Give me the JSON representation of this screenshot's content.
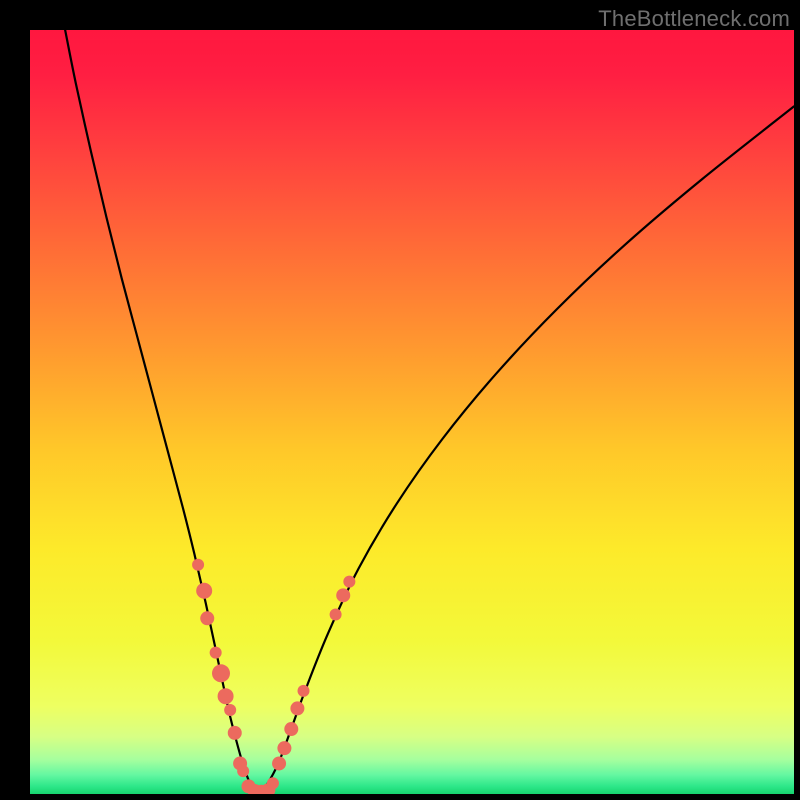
{
  "watermark": "TheBottleneck.com",
  "chart_data": {
    "type": "line",
    "title": "",
    "xlabel": "",
    "ylabel": "",
    "xlim": [
      0,
      100
    ],
    "ylim": [
      0,
      100
    ],
    "background_gradient": {
      "stops": [
        {
          "offset": 0.0,
          "color": "#ff173f"
        },
        {
          "offset": 0.06,
          "color": "#ff1f42"
        },
        {
          "offset": 0.15,
          "color": "#ff3d3f"
        },
        {
          "offset": 0.28,
          "color": "#ff6a37"
        },
        {
          "offset": 0.42,
          "color": "#ff9a2f"
        },
        {
          "offset": 0.55,
          "color": "#ffc829"
        },
        {
          "offset": 0.68,
          "color": "#fdea2a"
        },
        {
          "offset": 0.8,
          "color": "#f3f93a"
        },
        {
          "offset": 0.885,
          "color": "#eeff61"
        },
        {
          "offset": 0.925,
          "color": "#d7ff84"
        },
        {
          "offset": 0.955,
          "color": "#a6ff9e"
        },
        {
          "offset": 0.975,
          "color": "#64f7a1"
        },
        {
          "offset": 0.99,
          "color": "#2de789"
        },
        {
          "offset": 1.0,
          "color": "#16d46e"
        }
      ]
    },
    "series": [
      {
        "name": "left-branch",
        "x": [
          4.6,
          6,
          8,
          10,
          12,
          14,
          16,
          18,
          20,
          21.5,
          23,
          24.5,
          26,
          27,
          28,
          29,
          30
        ],
        "y": [
          100,
          93,
          84,
          75.5,
          67.5,
          60,
          52.5,
          45,
          37.5,
          31.5,
          25,
          18,
          11,
          7,
          3.5,
          1,
          0
        ]
      },
      {
        "name": "right-branch",
        "x": [
          30,
          31,
          32.5,
          34,
          36,
          39,
          43,
          48,
          54,
          61,
          69,
          78,
          88,
          100
        ],
        "y": [
          0,
          1.2,
          4,
          8,
          13.5,
          21,
          29.5,
          38,
          46.5,
          55,
          63.5,
          72,
          80.5,
          90
        ]
      }
    ],
    "scatter": {
      "name": "data-points",
      "color": "#ec6a5e",
      "points": [
        {
          "x": 22.0,
          "y": 30.0,
          "r": 6
        },
        {
          "x": 22.8,
          "y": 26.6,
          "r": 8
        },
        {
          "x": 23.2,
          "y": 23.0,
          "r": 7
        },
        {
          "x": 24.3,
          "y": 18.5,
          "r": 6
        },
        {
          "x": 25.0,
          "y": 15.8,
          "r": 9
        },
        {
          "x": 25.6,
          "y": 12.8,
          "r": 8
        },
        {
          "x": 26.2,
          "y": 11.0,
          "r": 6
        },
        {
          "x": 26.8,
          "y": 8.0,
          "r": 7
        },
        {
          "x": 27.5,
          "y": 4.0,
          "r": 7
        },
        {
          "x": 27.9,
          "y": 3.0,
          "r": 6
        },
        {
          "x": 28.6,
          "y": 1.0,
          "r": 7
        },
        {
          "x": 29.4,
          "y": 0.4,
          "r": 7
        },
        {
          "x": 30.3,
          "y": 0.3,
          "r": 7
        },
        {
          "x": 31.2,
          "y": 0.5,
          "r": 7
        },
        {
          "x": 31.8,
          "y": 1.4,
          "r": 6
        },
        {
          "x": 32.6,
          "y": 4.0,
          "r": 7
        },
        {
          "x": 33.3,
          "y": 6.0,
          "r": 7
        },
        {
          "x": 34.2,
          "y": 8.5,
          "r": 7
        },
        {
          "x": 35.0,
          "y": 11.2,
          "r": 7
        },
        {
          "x": 35.8,
          "y": 13.5,
          "r": 6
        },
        {
          "x": 40.0,
          "y": 23.5,
          "r": 6
        },
        {
          "x": 41.0,
          "y": 26.0,
          "r": 7
        },
        {
          "x": 41.8,
          "y": 27.8,
          "r": 6
        }
      ]
    }
  }
}
